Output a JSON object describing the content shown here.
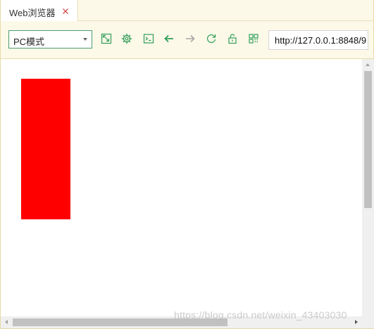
{
  "tab": {
    "title": "Web浏览器",
    "close_icon": "close-icon"
  },
  "toolbar": {
    "mode_select": {
      "value": "PC模式"
    },
    "buttons": [
      {
        "name": "resize-screen-button",
        "icon": "resize-icon"
      },
      {
        "name": "settings-button",
        "icon": "gear-icon"
      },
      {
        "name": "console-button",
        "icon": "terminal-icon"
      },
      {
        "name": "back-button",
        "icon": "arrow-left-icon"
      },
      {
        "name": "forward-button",
        "icon": "arrow-right-icon"
      },
      {
        "name": "refresh-button",
        "icon": "refresh-icon"
      },
      {
        "name": "lock-button",
        "icon": "unlock-icon"
      },
      {
        "name": "qr-code-button",
        "icon": "qr-code-icon"
      }
    ],
    "address": "http://127.0.0.1:8848/9"
  },
  "page": {
    "box_color": "#ff0000"
  },
  "colors": {
    "accent_green": "#2f9e58",
    "disabled_gray": "#a6a6a6",
    "chrome_bg": "#fdf9e9"
  },
  "watermark": "https://blog.csdn.net/weixin_43403030"
}
